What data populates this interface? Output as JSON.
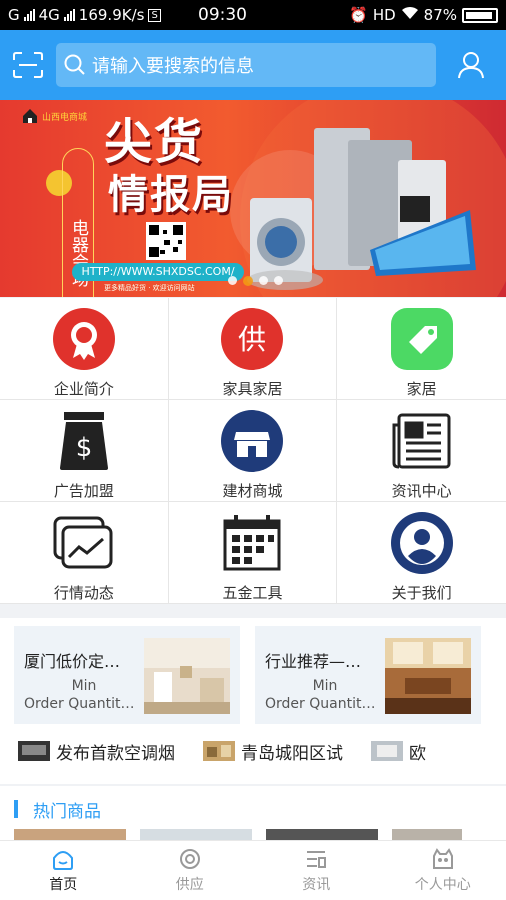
{
  "status": {
    "carrier1": "G",
    "carrier2": "4G",
    "speed": "169.9K/s",
    "time": "09:30",
    "hd": "HD",
    "battery": "87%"
  },
  "header": {
    "search_placeholder": "请输入要搜索的信息"
  },
  "banner": {
    "logo_text": "山西电商城",
    "side_text": "电器会场",
    "title_line1": "尖货",
    "title_line2": "情报局",
    "url": "HTTP://WWW.SHXDSC.COM/",
    "sub": "更多精品好货 · 欢迎访问网站",
    "active_dot": 2
  },
  "grid": [
    {
      "label": "企业简介",
      "icon": "award-icon"
    },
    {
      "label": "家具家居",
      "icon": "supply-icon"
    },
    {
      "label": "家居",
      "icon": "tag-icon"
    },
    {
      "label": "广告加盟",
      "icon": "money-bag-icon"
    },
    {
      "label": "建材商城",
      "icon": "store-icon"
    },
    {
      "label": "资讯中心",
      "icon": "newspaper-icon"
    },
    {
      "label": "行情动态",
      "icon": "trend-chart-icon"
    },
    {
      "label": "五金工具",
      "icon": "calendar-icon"
    },
    {
      "label": "关于我们",
      "icon": "user-circle-icon"
    }
  ],
  "cards": [
    {
      "title": "厦门低价定…",
      "line1": "Min",
      "line2": "Order Quantit…"
    },
    {
      "title": "行业推荐—…",
      "line1": "Min",
      "line2": "Order Quantit…"
    }
  ],
  "ticker": [
    "发布首款空调烟",
    "青岛城阳区试",
    "欧"
  ],
  "hot": {
    "title": "热门商品"
  },
  "tabs": [
    {
      "label": "首页",
      "icon": "home-icon"
    },
    {
      "label": "供应",
      "icon": "supply-tab-icon"
    },
    {
      "label": "资讯",
      "icon": "news-icon"
    },
    {
      "label": "个人中心",
      "icon": "profile-icon"
    }
  ],
  "colors": {
    "accent": "#2e9ef4",
    "red": "#e0322c",
    "green": "#4cd964",
    "navy": "#1f3b7a"
  }
}
